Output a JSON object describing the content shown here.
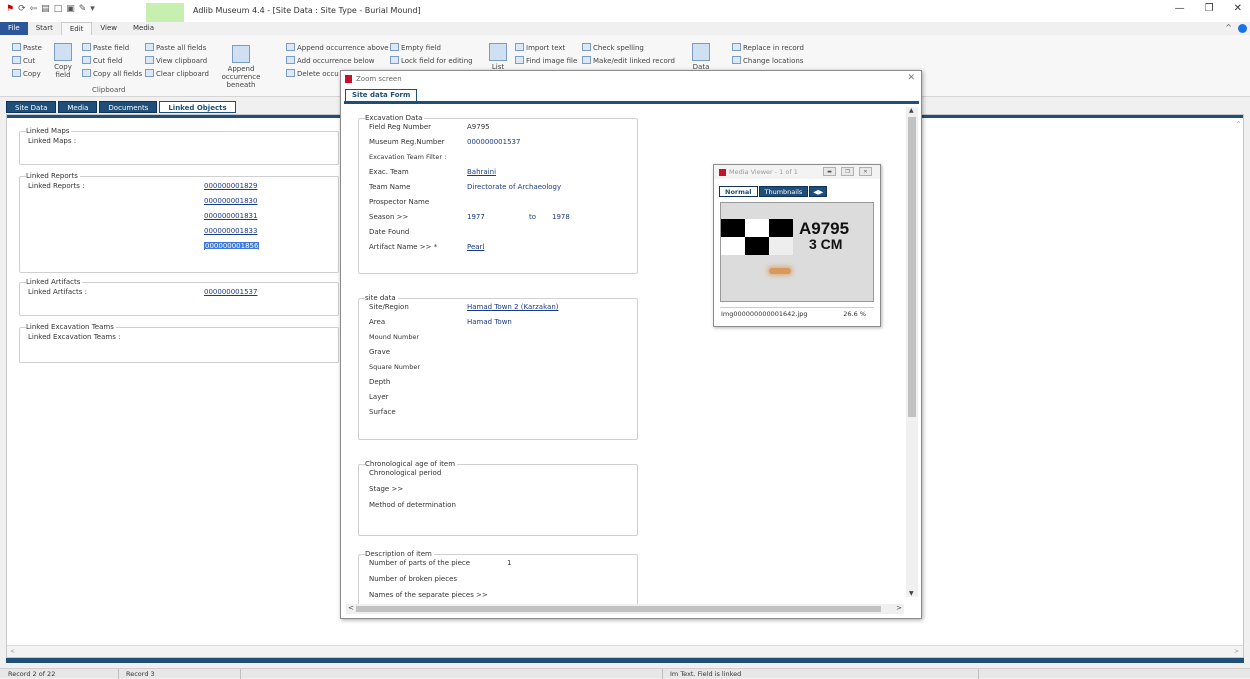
{
  "app": {
    "title": "Adlib Museum 4.4 - [Site Data : Site Type - Burial Mound]"
  },
  "menu": {
    "tabs": [
      "File",
      "Start",
      "Edit",
      "View",
      "Media"
    ]
  },
  "ribbon": {
    "paste": "Paste",
    "cut": "Cut",
    "copy": "Copy",
    "copy_field": "Copy\nfield",
    "paste_field": "Paste field",
    "cut_field": "Cut field",
    "copy_all_fields": "Copy all fields",
    "paste_all_fields": "Paste all fields",
    "view_clipboard": "View clipboard",
    "clear_clipboard": "Clear clipboard",
    "clipboard_group": "Clipboard",
    "append_occurrence_beneath": "Append occurrence beneath",
    "append_occurrence_above": "Append occurrence above",
    "add_occurrence_below": "Add occurrence below",
    "delete_occurrence": "Delete occu",
    "empty_field": "Empty field",
    "lock_field": "Lock field for editing",
    "list": "List",
    "import_text": "Import text",
    "find_image_file": "Find image file",
    "check_spelling": "Check spelling",
    "make_edit_linked": "Make/edit linked record",
    "data": "Data",
    "replace_in_record": "Replace in record",
    "change_locations": "Change locations"
  },
  "doc_tabs": [
    "Site Data",
    "Media",
    "Documents",
    "Linked Objects"
  ],
  "linked": {
    "maps_legend": "Linked Maps",
    "maps_label": "Linked Maps :",
    "reports_legend": "Linked Reports",
    "reports_label": "Linked Reports :",
    "reports": [
      "000000001829",
      "000000001830",
      "000000001831",
      "000000001833",
      "000000001856"
    ],
    "artifacts_legend": "Linked Artifacts",
    "artifacts_label": "Linked Artifacts :",
    "artifacts": [
      "000000001537"
    ],
    "teams_legend": "Linked Excavation Teams",
    "teams_label": "Linked Excavation Teams :"
  },
  "zoom": {
    "title": "Zoom screen",
    "tab": "Site data Form",
    "excavation": {
      "legend": "Excavation Data",
      "field_reg_label": "Field Reg Number",
      "field_reg_value": "A9795",
      "museum_reg_label": "Museum Reg.Number",
      "museum_reg_value": "000000001537",
      "team_filter_label": "Excavation Team Filter :",
      "exac_team_label": "Exac. Team",
      "exac_team_value": "Bahraini",
      "team_name_label": "Team Name",
      "team_name_value": "Directorate of Archaeology",
      "prospector_label": "Prospector Name",
      "season_label": "Season >>",
      "season_from": "1977",
      "season_to_label": "to",
      "season_to": "1978",
      "date_found_label": "Date Found",
      "artifact_label": "Artifact Name >> *",
      "artifact_value": "Pearl"
    },
    "site": {
      "legend": "site data",
      "region_label": "Site/Region",
      "region_value": "Hamad Town 2 (Karzakan)",
      "area_label": "Area",
      "area_value": "Hamad Town",
      "mound_label": "Mound Number",
      "grave_label": "Grave",
      "square_label": "Square Number",
      "depth_label": "Depth",
      "layer_label": "Layer",
      "surface_label": "Surface"
    },
    "chrono": {
      "legend": "Chronological age of item",
      "period_label": "Chronological period",
      "stage_label": "Stage >>",
      "method_label": "Method of determination"
    },
    "desc": {
      "legend": "Description of item",
      "parts_label": "Number of parts of the piece",
      "parts_value": "1",
      "broken_label": "Number of broken pieces",
      "names_label": "Names of the separate pieces >>"
    }
  },
  "media_viewer": {
    "title": "Media Viewer - 1 of 1",
    "tabs": [
      "Normal",
      "Thumbnails"
    ],
    "image_label_1": "A9795",
    "image_label_2": "3 CM",
    "filename": "Img000000000001642.jpg",
    "zoom": "26.6 %"
  },
  "status": {
    "record_of": "Record 2 of 22",
    "record": "Record 3",
    "message": "Im Text. Field is linked"
  }
}
